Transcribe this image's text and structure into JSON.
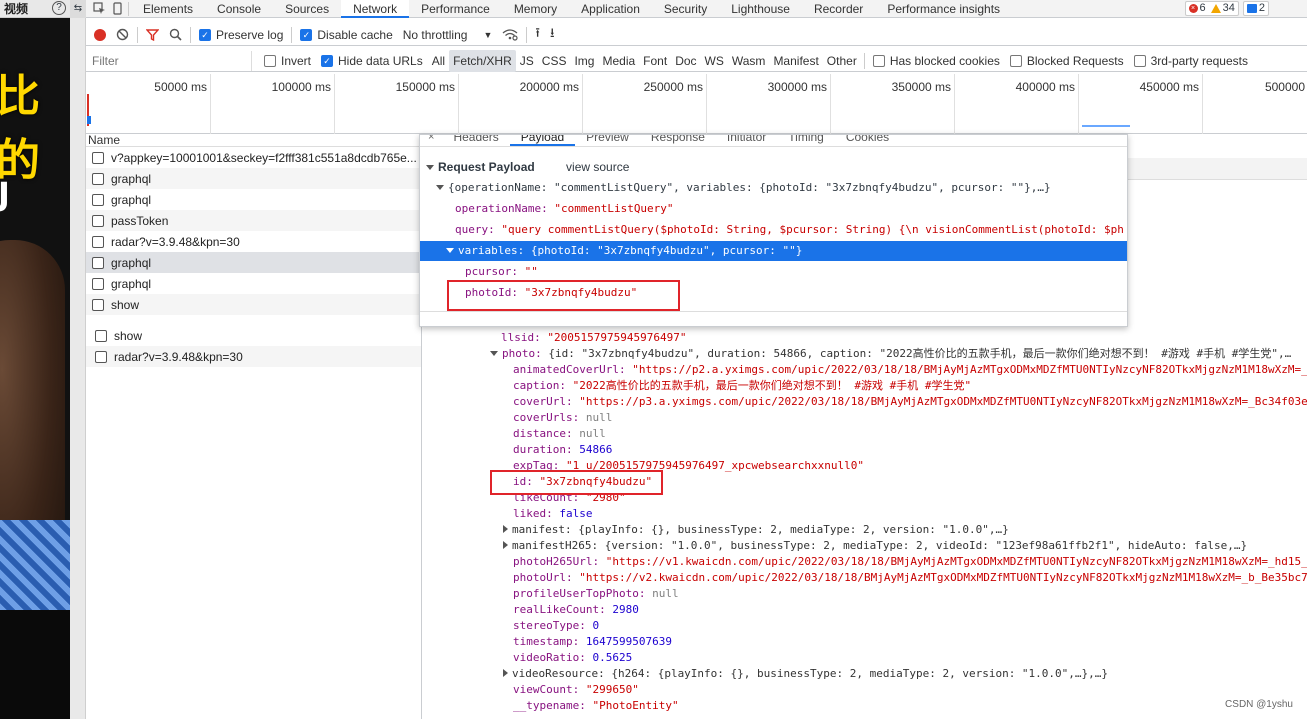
{
  "video": {
    "tab_label": "视频",
    "help_glyph": "?",
    "overlay_text_yellow": "比的",
    "overlay_text_white": "J"
  },
  "devtools": {
    "tabs": [
      "Elements",
      "Console",
      "Sources",
      "Network",
      "Performance",
      "Memory",
      "Application",
      "Security",
      "Lighthouse",
      "Recorder",
      "Performance insights"
    ],
    "active_tab": "Network",
    "badges": {
      "errors": "6",
      "warnings": "34",
      "messages": "2"
    }
  },
  "toolbar": {
    "preserve_log": "Preserve log",
    "disable_cache": "Disable cache",
    "throttling": "No throttling"
  },
  "filterbar": {
    "placeholder": "Filter",
    "invert": "Invert",
    "hide_data_urls": "Hide data URLs",
    "types": [
      "All",
      "Fetch/XHR",
      "JS",
      "CSS",
      "Img",
      "Media",
      "Font",
      "Doc",
      "WS",
      "Wasm",
      "Manifest",
      "Other"
    ],
    "active_type": "Fetch/XHR",
    "has_blocked_cookies": "Has blocked cookies",
    "blocked_requests": "Blocked Requests",
    "third_party": "3rd-party requests"
  },
  "overview": {
    "ticks": [
      "50000 ms",
      "100000 ms",
      "150000 ms",
      "200000 ms",
      "250000 ms",
      "300000 ms",
      "350000 ms",
      "400000 ms",
      "450000 ms",
      "500000"
    ]
  },
  "requests": {
    "header": "Name",
    "items": [
      "v?appkey=10001001&seckey=f2fff381c551a8dcdb765e...",
      "graphql",
      "graphql",
      "passToken",
      "radar?v=3.9.48&kpn=30",
      "graphql",
      "graphql",
      "show",
      "show",
      "radar?v=3.9.48&kpn=30"
    ]
  },
  "payload": {
    "tabs": [
      "Headers",
      "Payload",
      "Preview",
      "Response",
      "Initiator",
      "Timing",
      "Cookies"
    ],
    "active_tab": "Payload",
    "close": "×",
    "section_title": "Request Payload",
    "view_source": "view source",
    "summary": "{operationName: \"commentListQuery\", variables: {photoId: \"3x7zbnqfy4budzu\", pcursor: \"\"},…}",
    "operation_key": "operationName:",
    "operation_val": "\"commentListQuery\"",
    "query_key": "query:",
    "query_val": "\"query commentListQuery($photoId: String, $pcursor: String) {\\n  visionCommentList(photoId: $ph",
    "variables_line": "variables: {photoId: \"3x7zbnqfy4budzu\", pcursor: \"\"}",
    "pcursor_key": "pcursor:",
    "pcursor_val": "\"\"",
    "photoid_key": "photoId:",
    "photoid_val": "\"3x7zbnqfy4budzu\""
  },
  "response": {
    "llsid_key": "llsid:",
    "llsid_val": "\"2005157975945976497\"",
    "photo_key": "photo:",
    "photo_summary": "{id: \"3x7zbnqfy4budzu\", duration: 54866, caption: \"2022高性价比的五款手机，最后一款你们绝对想不到！ #游戏 #手机 #学生党\",…",
    "lines": [
      {
        "k": "animatedCoverUrl:",
        "v": "\"https://p2.a.yximgs.com/upic/2022/03/18/18/BMjAyMjAzMTgxODMxMDZfMTU0NTIyNzcyNF82OTkxMjgzNzM1M18wXzM=_a",
        "t": "s"
      },
      {
        "k": "caption:",
        "v": "\"2022高性价比的五款手机，最后一款你们绝对想不到！ #游戏  #手机 #学生党\"",
        "t": "s"
      },
      {
        "k": "coverUrl:",
        "v": "\"https://p3.a.yximgs.com/upic/2022/03/18/18/BMjAyMjAzMTgxODMxMDZfMTU0NTIyNzcyNF82OTkxMjgzNzM1M18wXzM=_Bc34f03e2",
        "t": "s"
      },
      {
        "k": "coverUrls:",
        "v": "null",
        "t": "nl"
      },
      {
        "k": "distance:",
        "v": "null",
        "t": "nl"
      },
      {
        "k": "duration:",
        "v": "54866",
        "t": "n"
      },
      {
        "k": "expTag:",
        "v": "\"1_u/2005157975945976497_xpcwebsearchxxnull0\"",
        "t": "s"
      },
      {
        "k": "id:",
        "v": "\"3x7zbnqfy4budzu\"",
        "t": "s"
      },
      {
        "k": "likeCount:",
        "v": "\"2980\"",
        "t": "s"
      },
      {
        "k": "liked:",
        "v": "false",
        "t": "n"
      }
    ],
    "manifest": "manifest: {playInfo: {}, businessType: 2, mediaType: 2, version: \"1.0.0\",…}",
    "manifestH265": "manifestH265: {version: \"1.0.0\", businessType: 2, mediaType: 2, videoId: \"123ef98a61ffb2f1\", hideAuto: false,…}",
    "lines2": [
      {
        "k": "photoH265Url:",
        "v": "\"https://v1.kwaicdn.com/upic/2022/03/18/18/BMjAyMjAzMTgxODMxMDZfMTU0NTIyNzcyNF82OTkxMjgzNzM1M18wXzM=_hd15_B",
        "t": "s"
      },
      {
        "k": "photoUrl:",
        "v": "\"https://v2.kwaicdn.com/upic/2022/03/18/18/BMjAyMjAzMTgxODMxMDZfMTU0NTIyNzcyNF82OTkxMjgzNzM1M18wXzM=_b_Be35bc7b",
        "t": "s"
      },
      {
        "k": "profileUserTopPhoto:",
        "v": "null",
        "t": "nl"
      },
      {
        "k": "realLikeCount:",
        "v": "2980",
        "t": "n"
      },
      {
        "k": "stereoType:",
        "v": "0",
        "t": "n"
      },
      {
        "k": "timestamp:",
        "v": "1647599507639",
        "t": "n"
      },
      {
        "k": "videoRatio:",
        "v": "0.5625",
        "t": "n"
      }
    ],
    "videoResource": "videoResource: {h264: {playInfo: {}, businessType: 2, mediaType: 2, version: \"1.0.0\",…},…}",
    "viewcount_key": "viewCount:",
    "viewcount_val": "\"299650\"",
    "typename_key": "__typename:",
    "typename_val": "\"PhotoEntity\""
  },
  "watermark": "CSDN @1yshu"
}
